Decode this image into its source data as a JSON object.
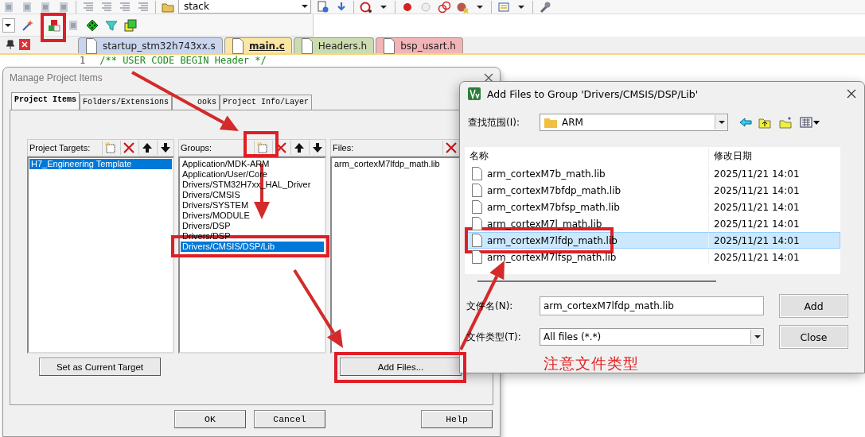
{
  "toolbar": {
    "target_combo": "stack"
  },
  "editor_tabs": [
    {
      "label": "startup_stm32h743xx.s",
      "color": "#c9d5ee",
      "selected": false
    },
    {
      "label": "main.c",
      "color": "#fbe6a2",
      "selected": true
    },
    {
      "label": "Headers.h",
      "color": "#cddcb0",
      "selected": false
    },
    {
      "label": "bsp_usart.h",
      "color": "#f2b4b6",
      "selected": false
    }
  ],
  "editor": {
    "line_number": "1",
    "code": "/** USER CODE BEGIN Header */"
  },
  "manage_dialog": {
    "title": "Manage Project Items",
    "tabs": [
      {
        "label": "Project Items",
        "selected": true
      },
      {
        "label": "Folders/Extensions",
        "selected": false
      },
      {
        "label": "ooks",
        "selected": false
      },
      {
        "label": "Project Info/Layer",
        "selected": false
      }
    ],
    "targets": {
      "label": "Project Targets:",
      "items": [
        {
          "label": "H7_Engineering Template",
          "selected": true
        }
      ]
    },
    "groups": {
      "label": "Groups:",
      "items": [
        {
          "label": "Application/MDK-ARM",
          "selected": false
        },
        {
          "label": "Application/User/Core",
          "selected": false
        },
        {
          "label": "Drivers/STM32H7xx_HAL_Driver",
          "selected": false
        },
        {
          "label": "Drivers/CMSIS",
          "selected": false
        },
        {
          "label": "Drivers/SYSTEM",
          "selected": false
        },
        {
          "label": "Drivers/MODULE",
          "selected": false
        },
        {
          "label": "Drivers/DSP",
          "selected": false
        },
        {
          "label": "Drivers/DSP",
          "selected": false
        },
        {
          "label": "Drivers/CMSIS/DSP/Lib",
          "selected": true
        }
      ]
    },
    "files": {
      "label": "Files:",
      "items": [
        {
          "label": "arm_cortexM7lfdp_math.lib",
          "selected": false
        }
      ]
    },
    "set_target_button": "Set as Current Target",
    "add_files_button": "Add Files...",
    "buttons": [
      "OK",
      "Cancel",
      "Help"
    ]
  },
  "add_files_dialog": {
    "title": "Add Files to Group 'Drivers/CMSIS/DSP/Lib'",
    "look_in_label": "查找范围(I):",
    "look_in_value": "ARM",
    "columns": [
      "名称",
      "修改日期"
    ],
    "rows": [
      {
        "name": "arm_cortexM7b_math.lib",
        "modified": "2025/11/21 14:01",
        "selected": false
      },
      {
        "name": "arm_cortexM7bfdp_math.lib",
        "modified": "2025/11/21 14:01",
        "selected": false
      },
      {
        "name": "arm_cortexM7bfsp_math.lib",
        "modified": "2025/11/21 14:01",
        "selected": false
      },
      {
        "name": "arm_cortexM7l_math.lib",
        "modified": "2025/11/21 14:01",
        "selected": false
      },
      {
        "name": "arm_cortexM7lfdp_math.lib",
        "modified": "2025/11/21 14:01",
        "selected": true
      },
      {
        "name": "arm_cortexM7lfsp_math.lib",
        "modified": "2025/11/21 14:01",
        "selected": false
      }
    ],
    "file_name_label": "文件名(N):",
    "file_name_value": "arm_cortexM7lfdp_math.lib",
    "file_type_label": "文件类型(T):",
    "file_type_value": "All files (*.*)",
    "buttons": [
      "Add",
      "Close"
    ]
  },
  "annotation": {
    "note": "注意文件类型"
  }
}
